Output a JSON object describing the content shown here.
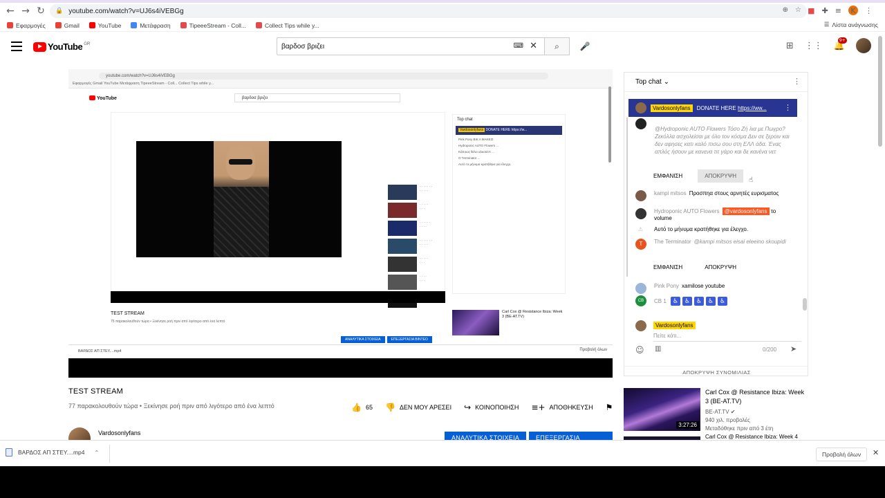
{
  "browser": {
    "url": "youtube.com/watch?v=UJ6s4iVEBGg",
    "bookmarks": [
      {
        "label": "Εφαρμογές",
        "color": "#ea4335"
      },
      {
        "label": "Gmail",
        "color": "#ea4335"
      },
      {
        "label": "YouTube",
        "color": "#ff0000"
      },
      {
        "label": "Μετάφραση",
        "color": "#4285f4"
      },
      {
        "label": "TipeeeStream - Coll...",
        "color": "#e04b4b"
      },
      {
        "label": "Collect Tips while y...",
        "color": "#e04b4b"
      }
    ],
    "reading_list": "Λίστα ανάγνωσης",
    "profile_initial": "K"
  },
  "youtube": {
    "logo_text": "YouTube",
    "logo_region": "GR",
    "search_query": "βαρδοσ βριζει",
    "notification_count": "9+"
  },
  "player": {
    "inner": {
      "url": "youtube.com/watch?v=UJ6s4iVEBGg",
      "bookmarks": "Εφαρμογές   Gmail   YouTube   Μετάφραση   TipeeeStream - Coll...   Collect Tips while y...",
      "search": "βαρδοσ βριζει",
      "top_chat": "Top chat",
      "donate_name": "Vardosonlyfans",
      "donate_msg": "DONATE HERE https://w...",
      "chat_lines": [
        "Pink Pony  ΒΙΚ Α ΜΑΚΕΙΣ",
        "Hydroponic AUTO Flowers ...",
        "Κάποιος θέλει αλκοτέστ ...",
        "Ο Τerminator ...",
        "Αυτό το μήνυμα κρατήθηκε για έλεγχο."
      ],
      "title": "TEST STREAM",
      "sub": "75 παρακολουθούν τώρα • Ξεκίνησε ροή πριν από λιγότερο από ένα λεπτό",
      "btn_analytics": "ΑΝΑΛΥΤΙΚΑ ΣΤΟΙΧΕΙΑ",
      "btn_edit": "ΕΠΕΞΕΡΓΑΣΙΑ ΒΙΝΤΕΟ",
      "rec_title": "Carl Cox @ Resistance Ibiza: Week 3 (BE-AT.TV)",
      "download": "ΒΑΡΔΟΣ ΑΠ ΣΤΕΥ....mp4",
      "show_all": "Προβολή όλων"
    }
  },
  "video": {
    "title": "TEST STREAM",
    "meta": "77 παρακολουθούν τώρα • Ξεκίνησε ροή πριν από λιγότερο από ένα λεπτό",
    "likes": "65",
    "dislike_label": "ΔΕΝ ΜΟΥ ΑΡΕΣΕΙ",
    "share_label": "ΚΟΙΝΟΠΟΙΗΣΗ",
    "save_label": "ΑΠΟΘΗΚΕΥΣΗ",
    "channel": "Vardosonlyfans",
    "analytics_label": "ΑΝΑΛΥΤΙΚΑ ΣΤΟΙΧΕΙΑ",
    "edit_label": "ΕΠΕΞΕΡΓΑΣΙΑ ΒΙΝΤΕΟ"
  },
  "chat": {
    "header": "Top chat",
    "pinned": {
      "name": "Vardosonlyfans",
      "message": "DONATE HERE ",
      "link": "https://ww..."
    },
    "held_message": "@Hydroponic AUTO Flowers Τόσο Ζή λια με Πωγρο? Ζεκόλλα ασχολείσαι με όλο τον κόσμα Δεν σε ξεροιν και δεν αφησες κατι καλό πισω σου στη ΕΛΛ άδα. Ένας απλός ήσουν με κανενα τιτ γάρο και δε κανένα νετ",
    "show_label": "ΕΜΦΑΝΙΣΗ",
    "hide_label": "ΑΠΟΚΡΥΨΗ",
    "messages": [
      {
        "author": "kampi mitsos",
        "text": "Προσπηα στους αρνητές ευρισματος",
        "avatar": "#7a5a48"
      },
      {
        "author": "Hydroponic AUTO Flowers",
        "mention": "@vardosonlyfans",
        "text": "το volume",
        "avatar": "#333333"
      }
    ],
    "held_notice": "Αυτό το μήνυμα κρατήθηκε για έλεγχο.",
    "terminator": {
      "author": "The Terminator",
      "text": "@kampi mitsos eisai eleeino skoupidi",
      "avatar": "#e8541e",
      "initial": "T"
    },
    "pink_pony": {
      "author": "Pink Pony",
      "text": "xamilose youtube",
      "avatar": "#9ab6d8"
    },
    "cb": {
      "author": "CB 1",
      "avatar": "#1e8e3e",
      "initial": "CB",
      "emoji": [
        "♿",
        "♿",
        "♿",
        "♿",
        "♿"
      ]
    },
    "compose_name": "Vardosonlyfans",
    "compose_placeholder": "Πείτε κάτι...",
    "char_count": "0/200",
    "hide_chat": "ΑΠΟΚΡΥΨΗ ΣΥΝΟΜΙΛΙΑΣ"
  },
  "recommendation": {
    "title": "Carl Cox @ Resistance Ibiza: Week 3 (BE-AT.TV)",
    "channel": "BE-AT.TV",
    "views": "940 χιλ. προβολές",
    "age": "Μεταδόθηκε πριν από 3 έτη",
    "duration": "3:27:26",
    "next_title": "Carl Cox @ Resistance Ibiza: Week 4 (BE-AT.TV)"
  },
  "downloads": {
    "file": "ΒΑΡΔΟΣ ΑΠ ΣΤΕΥ....mp4",
    "show_all": "Προβολή όλων"
  }
}
